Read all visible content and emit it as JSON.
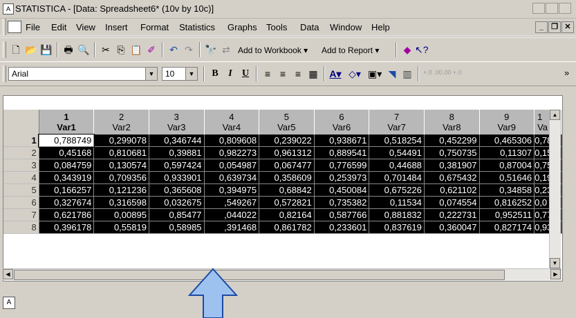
{
  "window": {
    "title": "STATISTICA - [Data: Spreadsheet6* (10v by 10c)]",
    "app_icon": "statistica-graph-icon"
  },
  "menu": {
    "items": [
      {
        "label": "File"
      },
      {
        "label": "Edit"
      },
      {
        "label": "View"
      },
      {
        "label": "Insert"
      },
      {
        "label": "Format"
      },
      {
        "label": "Statistics"
      },
      {
        "label": "Graphs"
      },
      {
        "label": "Tools"
      },
      {
        "label": "Data"
      },
      {
        "label": "Window"
      },
      {
        "label": "Help"
      }
    ],
    "mdi_buttons": [
      "_",
      "❐",
      "✕"
    ]
  },
  "toolbar1": {
    "add_to_workbook": "Add to Workbook ▾",
    "add_to_report": "Add to Report ▾"
  },
  "toolbar2": {
    "font": "Arial",
    "size": "10",
    "bold": "B",
    "italic": "I",
    "underline": "U",
    "dec_inc": "+.0 .00",
    "dec_dec": ".00 +.0",
    "overflow": "»"
  },
  "sheet": {
    "columns": [
      {
        "num": "1",
        "name": "Var1"
      },
      {
        "num": "2",
        "name": "Var2"
      },
      {
        "num": "3",
        "name": "Var3"
      },
      {
        "num": "4",
        "name": "Var4"
      },
      {
        "num": "5",
        "name": "Var5"
      },
      {
        "num": "6",
        "name": "Var6"
      },
      {
        "num": "7",
        "name": "Var7"
      },
      {
        "num": "8",
        "name": "Var8"
      },
      {
        "num": "9",
        "name": "Var9"
      },
      {
        "num": "1",
        "name": "Va"
      }
    ],
    "rows": [
      {
        "label": "1",
        "cells": [
          "0,788749",
          "0,299078",
          "0,346744",
          "0,809608",
          "0,239022",
          "0,938671",
          "0,518254",
          "0,452299",
          "0,465306",
          "0,78"
        ]
      },
      {
        "label": "2",
        "cells": [
          "0,45168",
          "0,810681",
          "0,39881",
          "0,982273",
          "0,961312",
          "0,889541",
          "0,54491",
          "0,750735",
          "0,11307",
          "0,15"
        ]
      },
      {
        "label": "3",
        "cells": [
          "0,084759",
          "0,130574",
          "0,597424",
          "0,054987",
          "0,067477",
          "0,776599",
          "0,44688",
          "0,381907",
          "0,87004",
          "0,75"
        ]
      },
      {
        "label": "4",
        "cells": [
          "0,343919",
          "0,709356",
          "0,933901",
          "0,639734",
          "0,358609",
          "0,253973",
          "0,701484",
          "0,675432",
          "0,51646",
          "0,19"
        ]
      },
      {
        "label": "5",
        "cells": [
          "0,166257",
          "0,121236",
          "0,365608",
          "0,394975",
          "0,68842",
          "0,450084",
          "0,675226",
          "0,621102",
          "0,34858",
          "0,23"
        ]
      },
      {
        "label": "6",
        "cells": [
          "0,327674",
          "0,316598",
          "0,032675",
          ",549267",
          "0,572821",
          "0,735382",
          "0,11534",
          "0,074554",
          "0,816252",
          "0,0"
        ]
      },
      {
        "label": "7",
        "cells": [
          "0,621786",
          "0,00895",
          "0,85477",
          ",044022",
          "0,82164",
          "0,587766",
          "0,881832",
          "0,222731",
          "0,952511",
          "0,77"
        ]
      },
      {
        "label": "8",
        "cells": [
          "0,396178",
          "0,55819",
          "0,58985",
          ",391468",
          "0,861782",
          "0,233601",
          "0,837619",
          "0,360047",
          "0,827174",
          "0,93"
        ]
      }
    ]
  },
  "colors": {
    "cell_bg": "#000000",
    "cell_fg": "#ffffff",
    "header_bg": "#b8b8b8",
    "arrow_fill": "#9ec2ef",
    "arrow_stroke": "#1b4aa6"
  }
}
